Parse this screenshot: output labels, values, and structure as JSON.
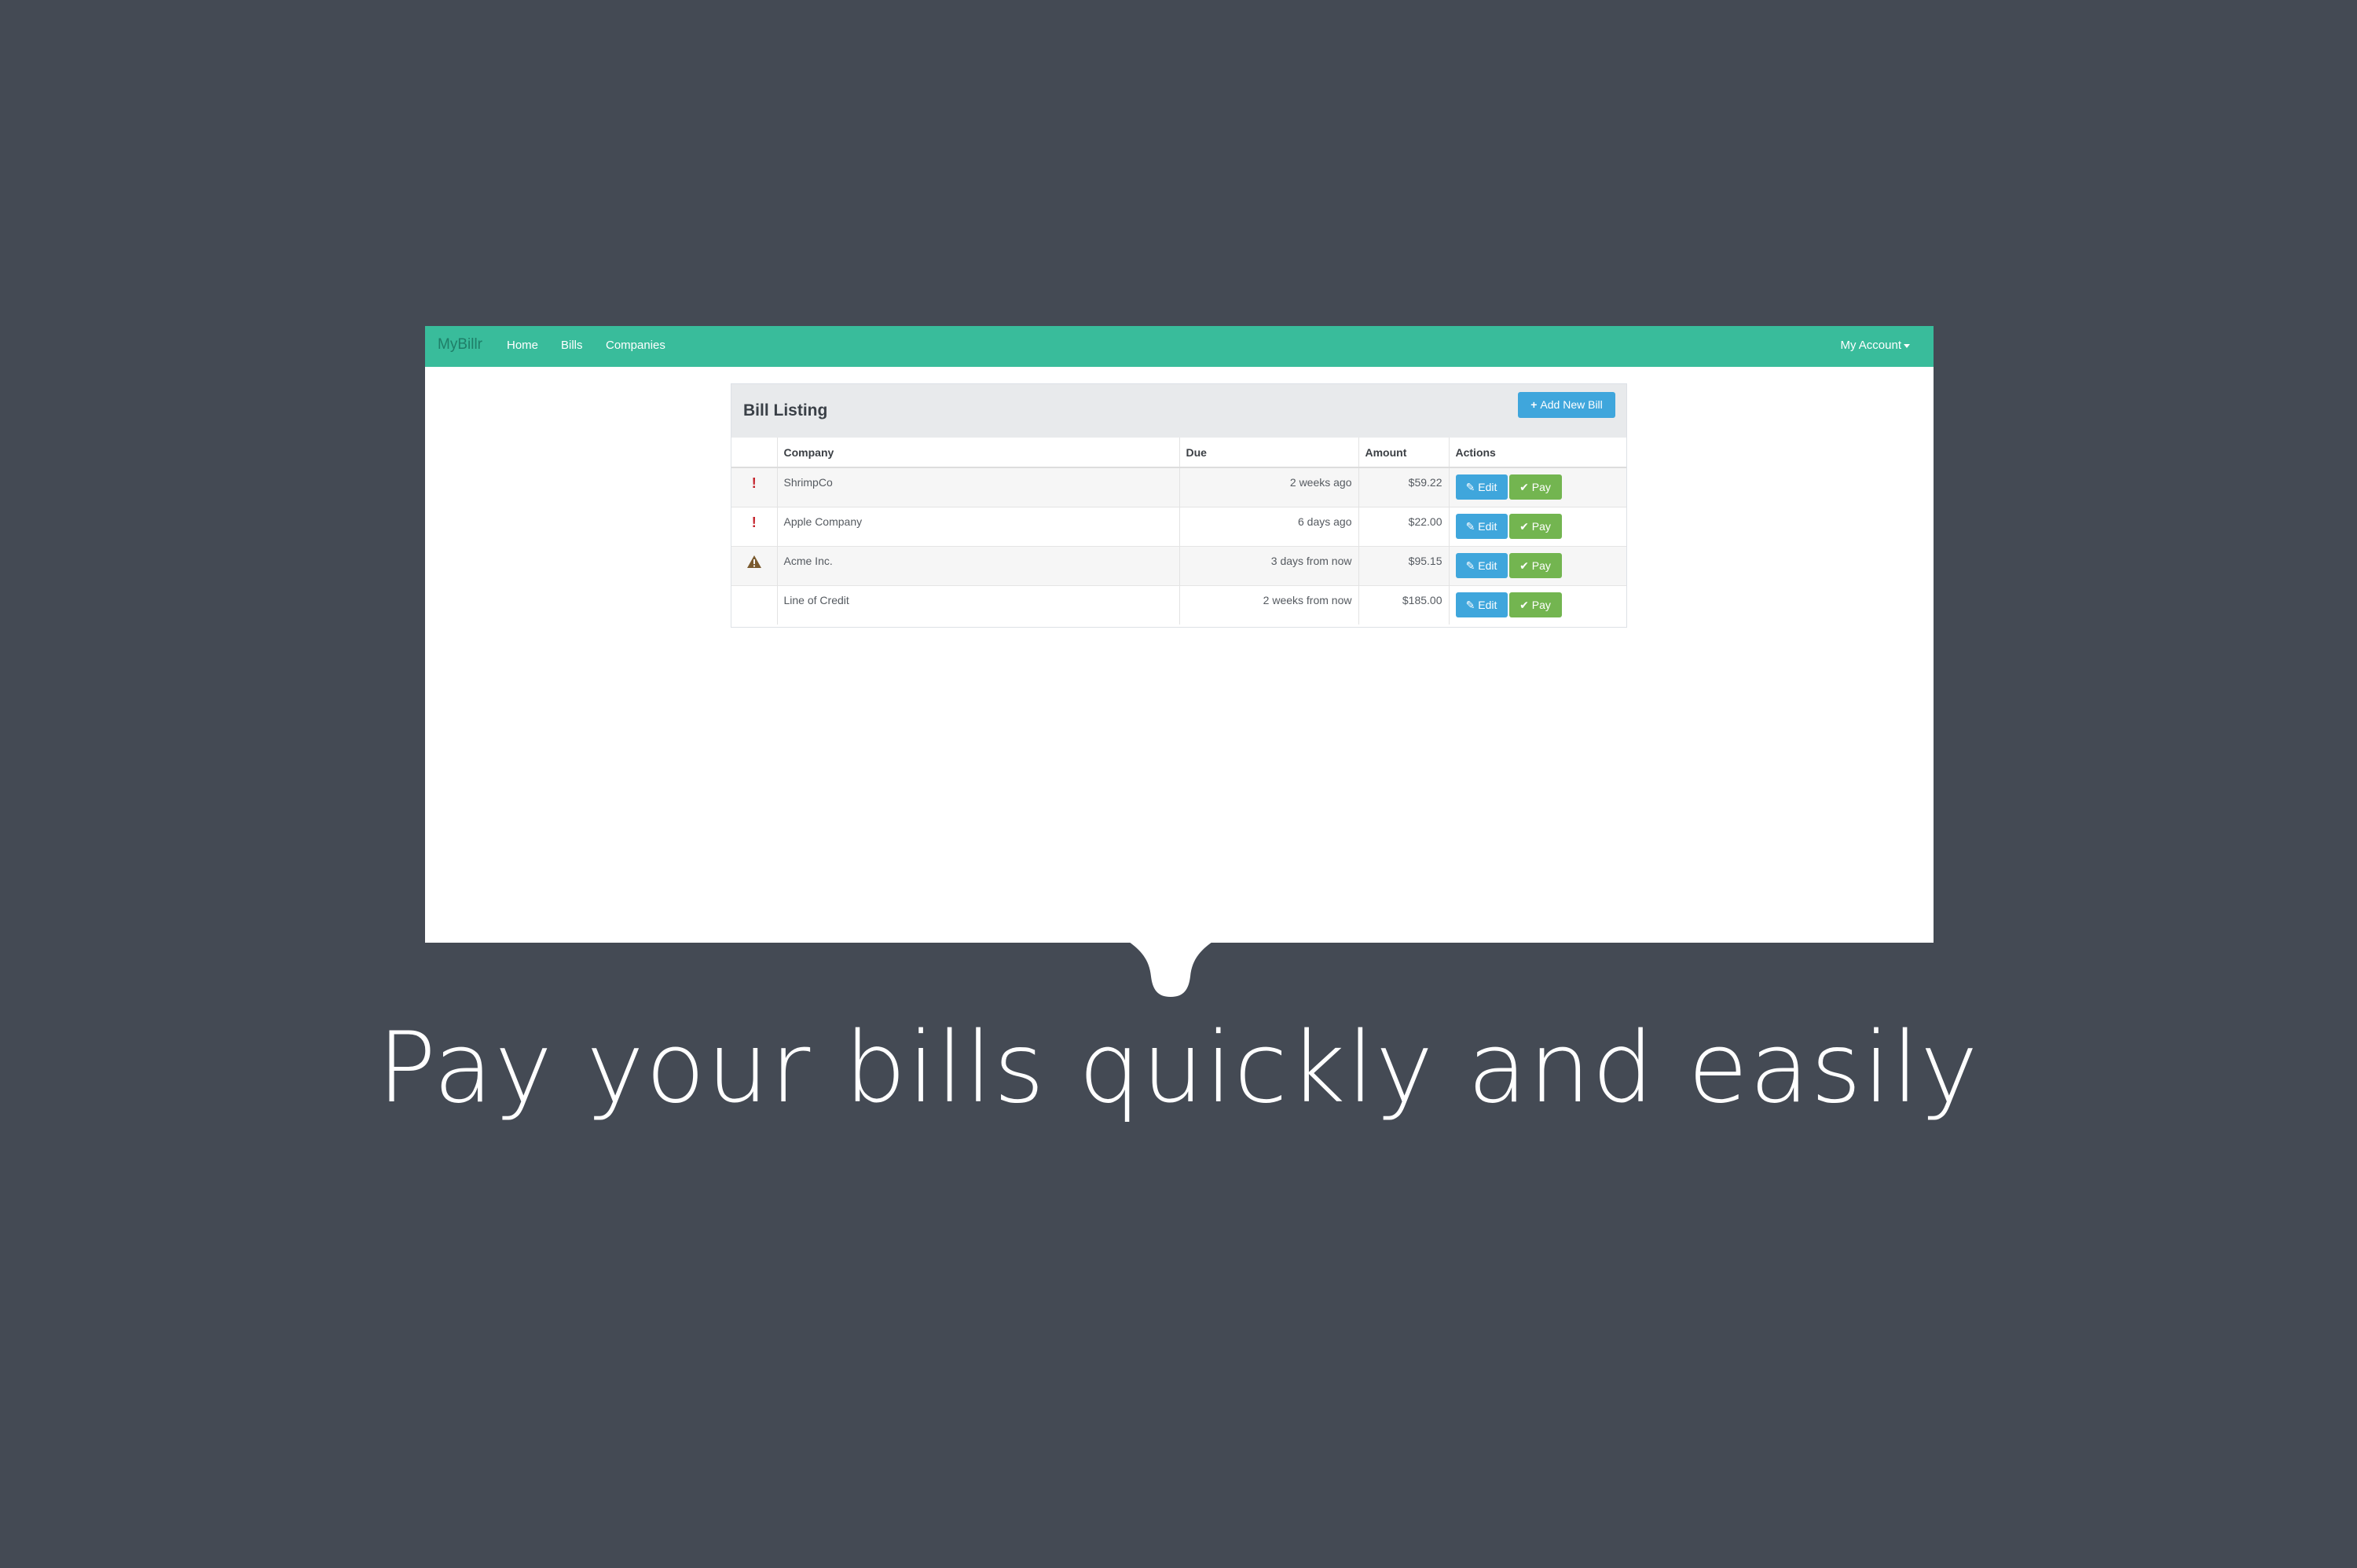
{
  "navbar": {
    "brand": "MyBillr",
    "links": [
      "Home",
      "Bills",
      "Companies"
    ],
    "account": "My Account"
  },
  "panel": {
    "title": "Bill Listing",
    "add_button": "Add New Bill"
  },
  "table": {
    "headers": [
      "",
      "Company",
      "Due",
      "Amount",
      "Actions"
    ],
    "rows": [
      {
        "status_icon": "exclamation-icon",
        "company": "ShrimpCo",
        "due": "2 weeks ago",
        "amount": "$59.22"
      },
      {
        "status_icon": "exclamation-icon",
        "company": "Apple Company",
        "due": "6 days ago",
        "amount": "$22.00"
      },
      {
        "status_icon": "warning-icon",
        "company": "Acme Inc.",
        "due": "3 days from now",
        "amount": "$95.15"
      },
      {
        "status_icon": "",
        "company": "Line of Credit",
        "due": "2 weeks from now",
        "amount": "$185.00"
      }
    ],
    "edit_label": "Edit",
    "pay_label": "Pay"
  },
  "tagline": "Pay your bills quickly and easily",
  "colors": {
    "background": "#444a54",
    "navbar": "#39bc9b",
    "primary_button": "#3fa6dc",
    "success_button": "#73b550",
    "danger": "#c4232c",
    "warning": "#7a5a2e"
  }
}
